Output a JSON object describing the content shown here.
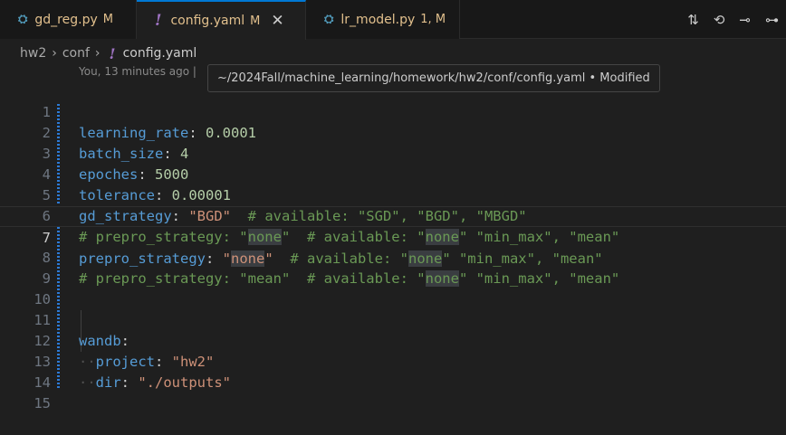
{
  "tabs": [
    {
      "icon": "python-icon",
      "icon_glyph": "⛭",
      "name": "gd_reg.py",
      "status": "M"
    },
    {
      "icon": "yaml-icon",
      "icon_glyph": "!",
      "name": "config.yaml",
      "status": "M",
      "close": "✕"
    },
    {
      "icon": "python-icon",
      "icon_glyph": "⛭",
      "name": "lr_model.py",
      "status": "1, M"
    }
  ],
  "tab_actions": [
    "⇅",
    "⟲",
    "⊸",
    "⊶"
  ],
  "breadcrumb": {
    "folder1": "hw2",
    "folder2": "conf",
    "file_icon": "!",
    "file": "config.yaml",
    "sep": "›"
  },
  "blame": "You, 13 minutes ago |",
  "tooltip": "~/2024Fall/machine_learning/homework/hw2/conf/config.yaml • Modified",
  "lines": {
    "l1": {
      "num": "1",
      "key": "learning_rate",
      "colon": ": ",
      "val": "0.0001"
    },
    "l2": {
      "num": "2",
      "key": "batch_size",
      "colon": ": ",
      "val": "4"
    },
    "l3": {
      "num": "3",
      "key": "epoches",
      "colon": ": ",
      "val": "5000"
    },
    "l4": {
      "num": "4",
      "key": "tolerance",
      "colon": ": ",
      "val": "0.00001"
    },
    "l5": {
      "num": "5",
      "key": "gd_strategy",
      "colon": ": ",
      "val": "\"BGD\"",
      "comment": "  # available: \"SGD\", \"BGD\", \"MBGD\""
    },
    "l6": {
      "num": "6",
      "c1": "# prepro_strategy: \"",
      "h1": "none",
      "c2": "\"  # available: \"",
      "h2": "none",
      "c3": "\" \"min_max\", \"mean\""
    },
    "l7": {
      "num": "7",
      "key": "prepro_strategy",
      "colon": ": ",
      "s1": "\"",
      "h1": "none",
      "s2": "\"",
      "c1": "  # available: \"",
      "h2": "none",
      "c2": "\" \"min_max\", \"mean\""
    },
    "l8": {
      "num": "8",
      "c1": "# prepro_strategy: \"mean\"  # available: \"",
      "h1": "none",
      "c2": "\" \"min_max\", \"mean\""
    },
    "l9": {
      "num": "9"
    },
    "l10": {
      "num": "10"
    },
    "l11": {
      "num": "11",
      "key": "wandb",
      "colon": ":"
    },
    "l12": {
      "num": "12",
      "ws": "··",
      "key": "project",
      "colon": ": ",
      "val": "\"hw2\""
    },
    "l13": {
      "num": "13",
      "ws": "··",
      "key": "dir",
      "colon": ": ",
      "val": "\"./outputs\""
    },
    "l14": {
      "num": "14"
    },
    "l15": {
      "num": "15"
    }
  }
}
